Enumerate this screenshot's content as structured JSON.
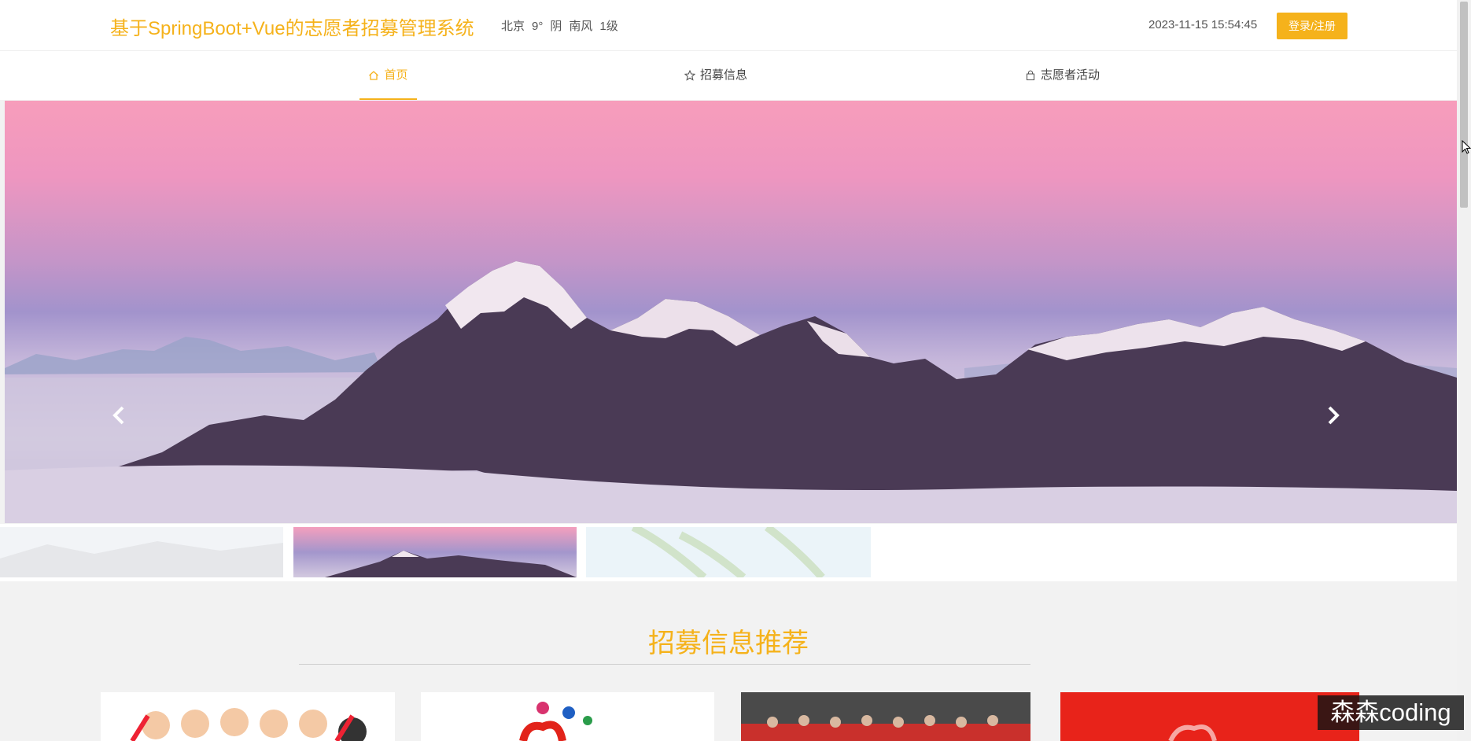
{
  "header": {
    "site_title": "基于SpringBoot+Vue的志愿者招募管理系统",
    "weather": {
      "city": "北京",
      "temp": "9°",
      "condition": "阴",
      "wind": "南风",
      "wind_level": "1级"
    },
    "datetime": "2023-11-15 15:54:45",
    "login_label": "登录/注册"
  },
  "nav": {
    "items": [
      {
        "label": "首页",
        "icon": "home-icon",
        "active": true
      },
      {
        "label": "招募信息",
        "icon": "star-icon",
        "active": false
      },
      {
        "label": "志愿者活动",
        "icon": "bag-icon",
        "active": false
      }
    ]
  },
  "carousel": {
    "current_slide": 2,
    "total_slides": 3,
    "prev_icon": "chevron-left-icon",
    "next_icon": "chevron-right-icon"
  },
  "section": {
    "title": "招募信息推荐"
  },
  "watermark": "森森coding",
  "colors": {
    "accent": "#f5b21b",
    "card_red": "#e8231a"
  }
}
